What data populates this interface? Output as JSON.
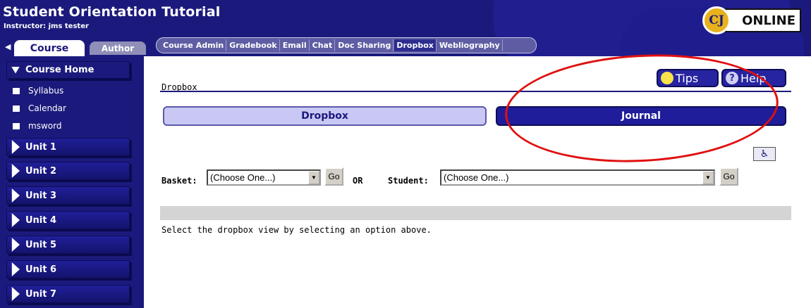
{
  "header": {
    "title": "Student Orientation Tutorial",
    "instructor": "Instructor: jms tester",
    "logo_text": "ONLINE",
    "logo_seal": "CJ"
  },
  "role_tabs": {
    "course": "Course",
    "author": "Author"
  },
  "tool_nav": [
    {
      "label": "Course Admin",
      "active": false
    },
    {
      "label": "Gradebook",
      "active": false
    },
    {
      "label": "Email",
      "active": false
    },
    {
      "label": "Chat",
      "active": false
    },
    {
      "label": "Doc Sharing",
      "active": false
    },
    {
      "label": "Dropbox",
      "active": true
    },
    {
      "label": "Webliography",
      "active": false
    }
  ],
  "sidebar": {
    "course_home": "Course Home",
    "links": [
      "Syllabus",
      "Calendar",
      "msword"
    ],
    "units": [
      "Unit 1",
      "Unit 2",
      "Unit 3",
      "Unit 4",
      "Unit 5",
      "Unit 6",
      "Unit 7"
    ]
  },
  "main": {
    "breadcrumb": "Dropbox",
    "tips_label": "Tips",
    "help_label": "Help",
    "dropbox_tab": "Dropbox",
    "journal_tab": "Journal",
    "basket_label": "Basket:",
    "basket_value": "(Choose One...)",
    "or_label": "OR",
    "student_label": "Student:",
    "student_value": "(Choose One...)",
    "go_label": "Go",
    "instruction": "Select the dropbox view by selecting an option above."
  },
  "colors": {
    "navy": "#1b1a7c",
    "annotation_red": "#e01010",
    "dropbox_tab_bg": "#c9c8f5"
  }
}
